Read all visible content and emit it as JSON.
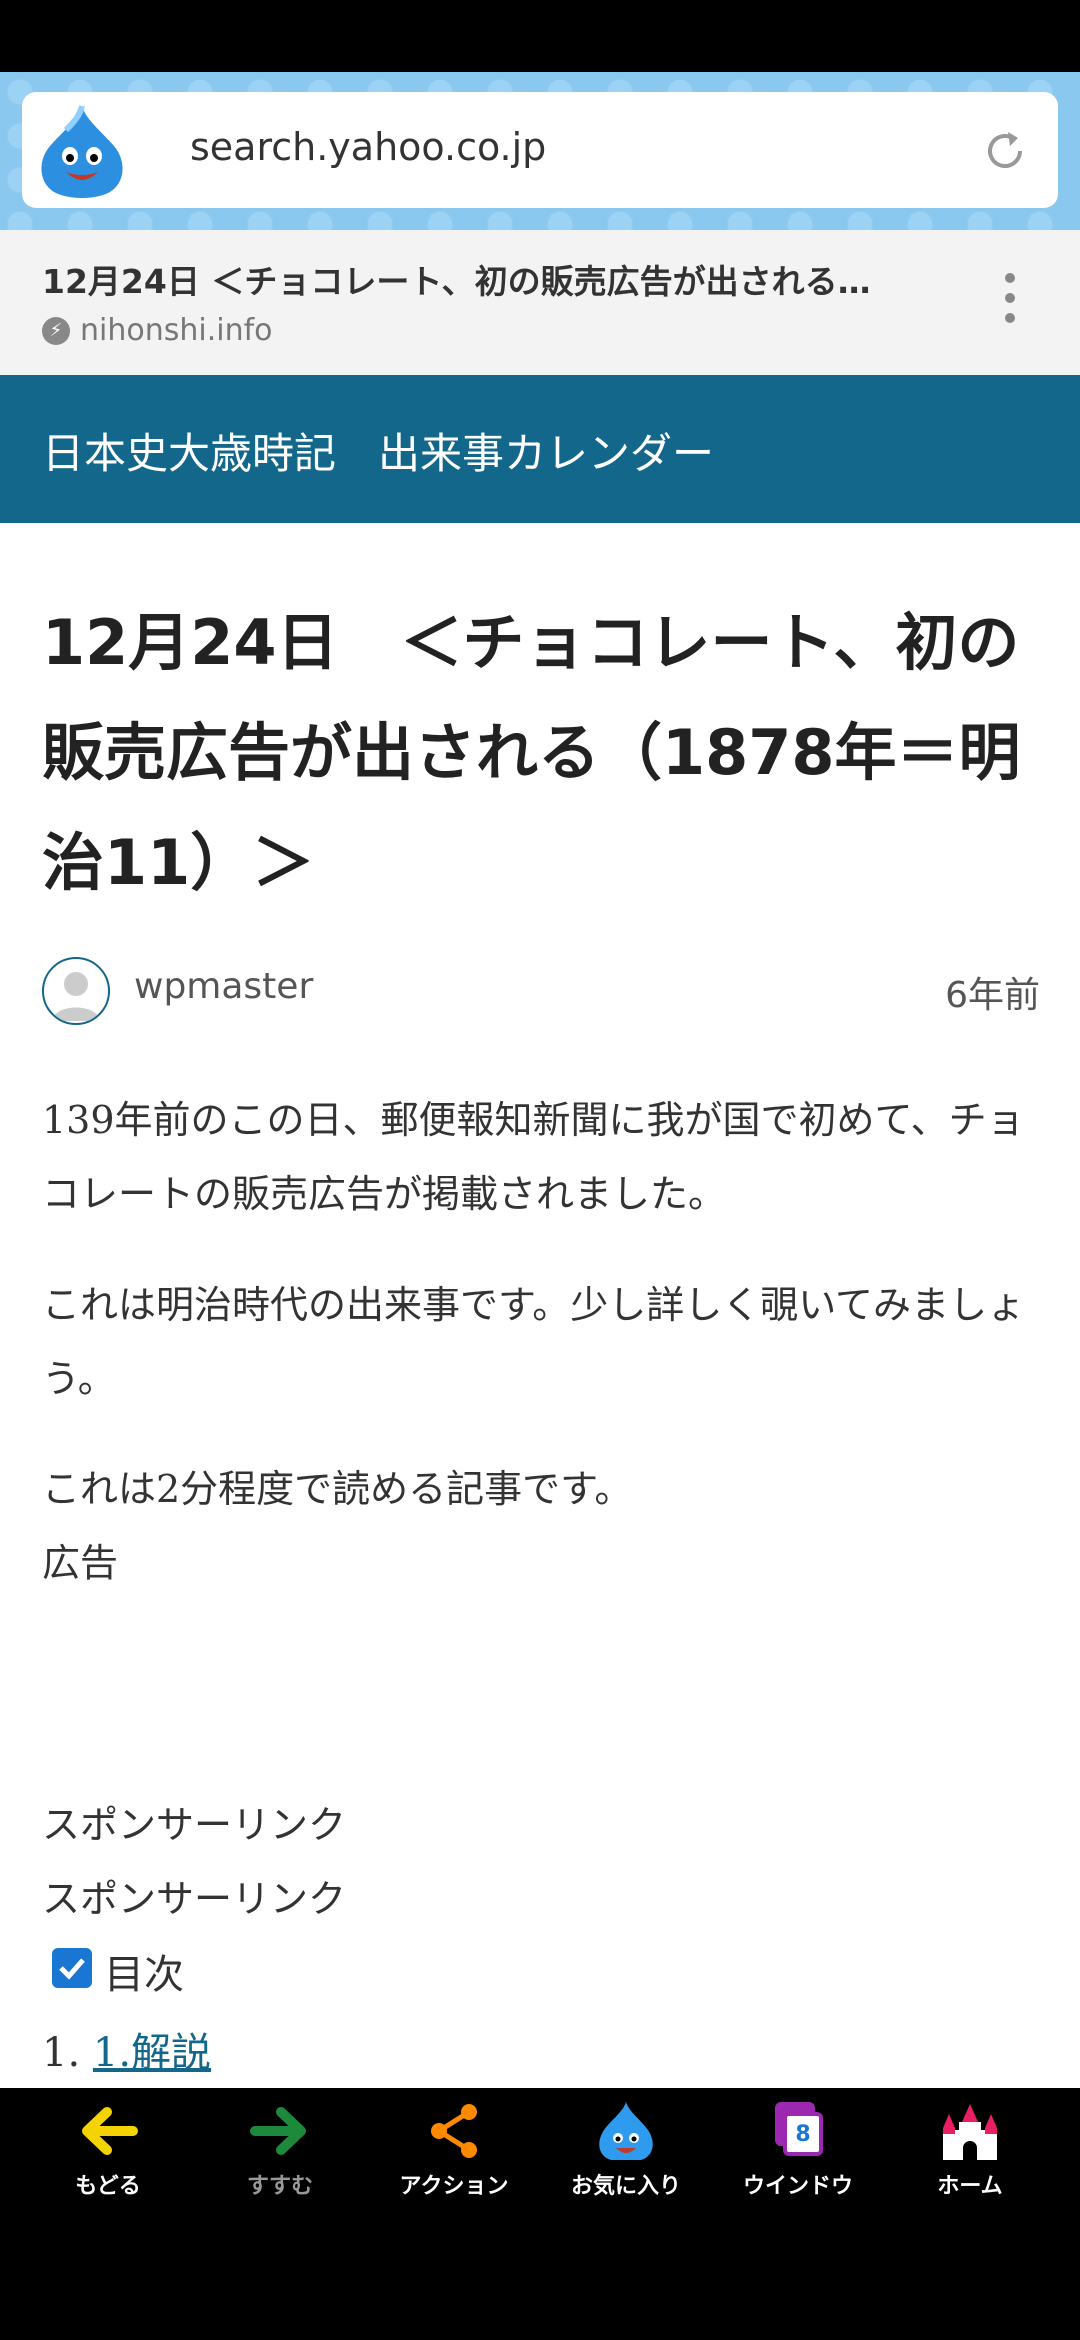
{
  "browser": {
    "url": "search.yahoo.co.jp",
    "page_title": "12月24日 ＜チョコレート、初の販売広告が出される…",
    "domain": "nihonshi.info"
  },
  "site": {
    "title": "日本史大歳時記　出来事カレンダー"
  },
  "article": {
    "title": "12月24日　＜チョコレート、初の販売広告が出される（1878年＝明治11）＞",
    "author": "wpmaster",
    "posted": "6年前",
    "paragraphs": [
      "139年前のこの日、郵便報知新聞に我が国で初めて、チョコレートの販売広告が掲載されました。",
      "これは明治時代の出来事です。少し詳しく覗いてみましょう。",
      "これは2分程度で読める記事です。"
    ],
    "ad_label": "広告",
    "sponsor_1": "スポンサーリンク",
    "sponsor_2": "スポンサーリンク",
    "toc_label": "目次",
    "toc_items": [
      {
        "number": "1.",
        "label": "1.解説"
      }
    ]
  },
  "bottom_nav": [
    {
      "label": "もどる",
      "icon": "back-arrow-icon",
      "color": "#f5d300"
    },
    {
      "label": "すすむ",
      "icon": "forward-arrow-icon",
      "color": "#1c8a3a"
    },
    {
      "label": "アクション",
      "icon": "share-icon",
      "color": "#ff8a00"
    },
    {
      "label": "お気に入り",
      "icon": "slime-icon",
      "color": "#2e9bef"
    },
    {
      "label": "ウインドウ",
      "icon": "window-icon",
      "color": "#9c27b0",
      "count": "8"
    },
    {
      "label": "ホーム",
      "icon": "castle-icon",
      "color": "#e91e63"
    }
  ]
}
